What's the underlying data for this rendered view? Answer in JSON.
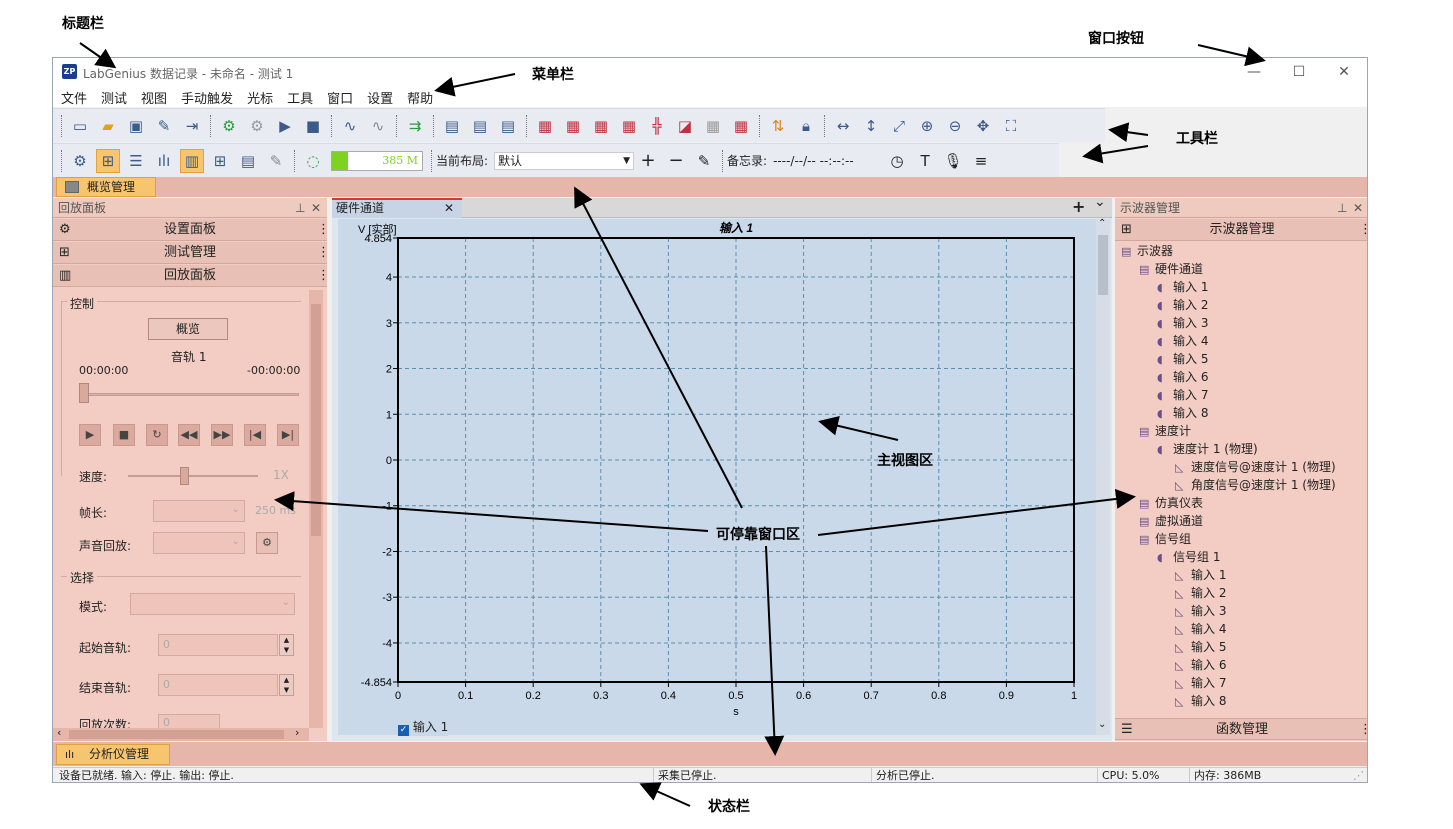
{
  "annotations": {
    "title_bar": "标题栏",
    "window_buttons": "窗口按钮",
    "menu_bar": "菜单栏",
    "toolbar": "工具栏",
    "main_view": "主视图区",
    "dockable": "可停靠窗口区",
    "status_bar": "状态栏"
  },
  "window": {
    "logo": "ZP",
    "title": "LabGenius 数据记录 - 未命名 - 测试 1",
    "minimize": "—",
    "maximize": "☐",
    "close": "✕"
  },
  "menu": [
    "文件",
    "测试",
    "视图",
    "手动触发",
    "光标",
    "工具",
    "窗口",
    "设置",
    "帮助"
  ],
  "toolbar2": {
    "memory_value": "385 M",
    "layout_label": "当前布局:",
    "layout_value": "默认",
    "memo_label": "备忘录:",
    "memo_value": "----/--/-- --:--:--"
  },
  "overview_tab": "概览管理",
  "left_panel": {
    "title": "回放面板",
    "sections": [
      "设置面板",
      "测试管理",
      "回放面板"
    ],
    "control_group": "控制",
    "overview_button": "概览",
    "track": "音轨 1",
    "time_start": "00:00:00",
    "time_end": "-00:00:00",
    "speed_label": "速度:",
    "speed_value": "1X",
    "frame_label": "帧长:",
    "frame_value": "250 ms",
    "audio_label": "声音回放:",
    "select_group": "选择",
    "mode_label": "模式:",
    "start_track_label": "起始音轨:",
    "start_track_value": "0",
    "end_track_label": "结束音轨:",
    "end_track_value": "0",
    "loop_label": "回放次数:",
    "loop_value": "0"
  },
  "center": {
    "tab": "硬件通道",
    "add": "+",
    "chevron": "⌄"
  },
  "chart_data": {
    "type": "line",
    "title": "输入 1",
    "ylabel": "V [实部]",
    "xlabel": "s",
    "ylim": [
      -4.854,
      4.854
    ],
    "xlim": [
      0,
      1
    ],
    "y_ticks": [
      "4.854",
      "4",
      "3",
      "2",
      "1",
      "0",
      "-1",
      "-2",
      "-3",
      "-4",
      "-4.854"
    ],
    "x_ticks": [
      "0",
      "0.1",
      "0.2",
      "0.3",
      "0.4",
      "0.5",
      "0.6",
      "0.7",
      "0.8",
      "0.9",
      "1"
    ],
    "grid": true,
    "series": [
      {
        "name": "输入 1",
        "values": []
      }
    ],
    "legend": "bottom-left"
  },
  "right_panel": {
    "title": "示波器管理",
    "section": "示波器管理",
    "bottom_section": "函数管理",
    "tree": [
      {
        "label": "示波器",
        "level": 0
      },
      {
        "label": "硬件通道",
        "level": 1
      },
      {
        "label": "输入 1",
        "level": 2
      },
      {
        "label": "输入 2",
        "level": 2
      },
      {
        "label": "输入 3",
        "level": 2
      },
      {
        "label": "输入 4",
        "level": 2
      },
      {
        "label": "输入 5",
        "level": 2
      },
      {
        "label": "输入 6",
        "level": 2
      },
      {
        "label": "输入 7",
        "level": 2
      },
      {
        "label": "输入 8",
        "level": 2
      },
      {
        "label": "速度计",
        "level": 1
      },
      {
        "label": "速度计 1 (物理)",
        "level": 2
      },
      {
        "label": "速度信号@速度计 1 (物理)",
        "level": 3
      },
      {
        "label": "角度信号@速度计 1 (物理)",
        "level": 3
      },
      {
        "label": "仿真仪表",
        "level": 1
      },
      {
        "label": "虚拟通道",
        "level": 1
      },
      {
        "label": "信号组",
        "level": 1
      },
      {
        "label": "信号组 1",
        "level": 2
      },
      {
        "label": "输入 1",
        "level": 3
      },
      {
        "label": "输入 2",
        "level": 3
      },
      {
        "label": "输入 3",
        "level": 3
      },
      {
        "label": "输入 4",
        "level": 3
      },
      {
        "label": "输入 5",
        "level": 3
      },
      {
        "label": "输入 6",
        "level": 3
      },
      {
        "label": "输入 7",
        "level": 3
      },
      {
        "label": "输入 8",
        "level": 3
      }
    ]
  },
  "bottom_tab": "分析仪管理",
  "status": {
    "device": "设备已就绪. 输入: 停止. 输出: 停止.",
    "acq": "采集已停止.",
    "analysis": "分析已停止.",
    "cpu": "CPU: 5.0%",
    "mem": "内存: 386MB"
  },
  "colors": {
    "dock": "#f3cdc4",
    "plot_bg": "#c9d9ea",
    "accent": "#f7c46f"
  }
}
